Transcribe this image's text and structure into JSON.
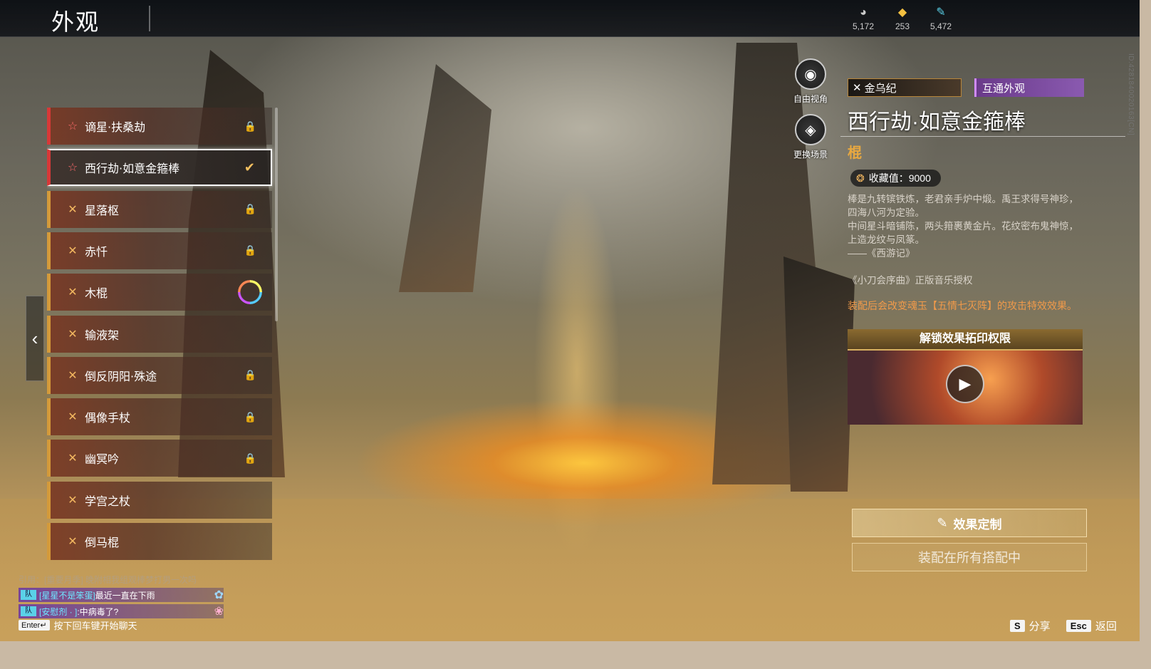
{
  "header": {
    "title": "外观",
    "currencies": [
      {
        "icon": "pearl-icon",
        "glyph": "◕",
        "value": "5,172"
      },
      {
        "icon": "gold-ingot-icon",
        "glyph": "◆",
        "value": "253"
      },
      {
        "icon": "feather-icon",
        "glyph": "✎",
        "value": "5,472"
      }
    ]
  },
  "weapon_list": [
    {
      "label": "谪星·扶桑劫",
      "icon": "star-icon",
      "glyph": "☆",
      "rarity": "red",
      "state": "locked"
    },
    {
      "label": "西行劫·如意金箍棒",
      "icon": "star-icon",
      "glyph": "☆",
      "rarity": "red",
      "state": "equipped"
    },
    {
      "label": "星落枢",
      "icon": "cross-weapons-icon",
      "glyph": "✕",
      "rarity": "gold",
      "state": "locked"
    },
    {
      "label": "赤忏",
      "icon": "cross-weapons-icon",
      "glyph": "✕",
      "rarity": "gold",
      "state": "locked"
    },
    {
      "label": "木棍",
      "icon": "cross-weapons-icon",
      "glyph": "✕",
      "rarity": "gold",
      "state": "dye"
    },
    {
      "label": "输液架",
      "icon": "cross-weapons-icon",
      "glyph": "✕",
      "rarity": "gold",
      "state": "none"
    },
    {
      "label": "倒反阴阳·殊途",
      "icon": "cross-weapons-icon",
      "glyph": "✕",
      "rarity": "gold",
      "state": "locked"
    },
    {
      "label": "偶像手杖",
      "icon": "cross-weapons-icon",
      "glyph": "✕",
      "rarity": "gold",
      "state": "locked"
    },
    {
      "label": "幽冥吟",
      "icon": "cross-weapons-icon",
      "glyph": "✕",
      "rarity": "gold",
      "state": "locked"
    },
    {
      "label": "学宫之杖",
      "icon": "cross-weapons-icon",
      "glyph": "✕",
      "rarity": "gold",
      "state": "none"
    },
    {
      "label": "倒马棍",
      "icon": "cross-weapons-icon",
      "glyph": "✕",
      "rarity": "gold",
      "state": "none"
    }
  ],
  "state_glyphs": {
    "locked": "🔒",
    "equipped": "✔"
  },
  "tools": {
    "free_view": {
      "label": "自由视角",
      "glyph": "◉"
    },
    "change_scene": {
      "label": "更换场景",
      "glyph": "◈"
    }
  },
  "detail": {
    "series_tag": "金乌纪",
    "series_glyph": "✕",
    "shared_tag": "互通外观",
    "name": "西行劫·如意金箍棒",
    "type": "棍",
    "collection": "收藏值：9000",
    "collection_glyph": "❂",
    "description": [
      "棒是九转镔铁炼，老君亲手炉中煅。禹王求得号神珍，四海八河为定验。",
      "中间星斗暗铺陈，两头箝裹黄金片。花纹密布鬼神惊，上造龙纹与凤篆。",
      "——《西游记》"
    ],
    "music_license": "《小刀会序曲》正版音乐授权",
    "effect_note": "装配后会改变魂玉【五情七灭阵】的攻击特效效果。",
    "video_title": "解锁效果拓印权限",
    "play_glyph": "▶"
  },
  "actions": {
    "effect_custom": "效果定制",
    "effect_custom_glyph": "✎",
    "equip_all": "装配在所有搭配中"
  },
  "side_id": "ID:4281840020163[CN]",
  "chat": {
    "faint": "引用：[重要月季] 晚附相我组观棒梦打男一次吗",
    "messages": [
      {
        "channel": "队",
        "name": "[星星不是笨蛋]",
        "text": "最近一直在下雨",
        "emoji": "✿"
      },
      {
        "channel": "队",
        "name": "[安慰剂 · ]",
        "text": ":中病毒了?",
        "emoji": "❀"
      }
    ],
    "hint_key": "Enter↵",
    "hint": "按下回车键开始聊天"
  },
  "hotkeys": [
    {
      "key": "S",
      "label": "分享"
    },
    {
      "key": "Esc",
      "label": "返回"
    }
  ],
  "back_glyph": "‹"
}
